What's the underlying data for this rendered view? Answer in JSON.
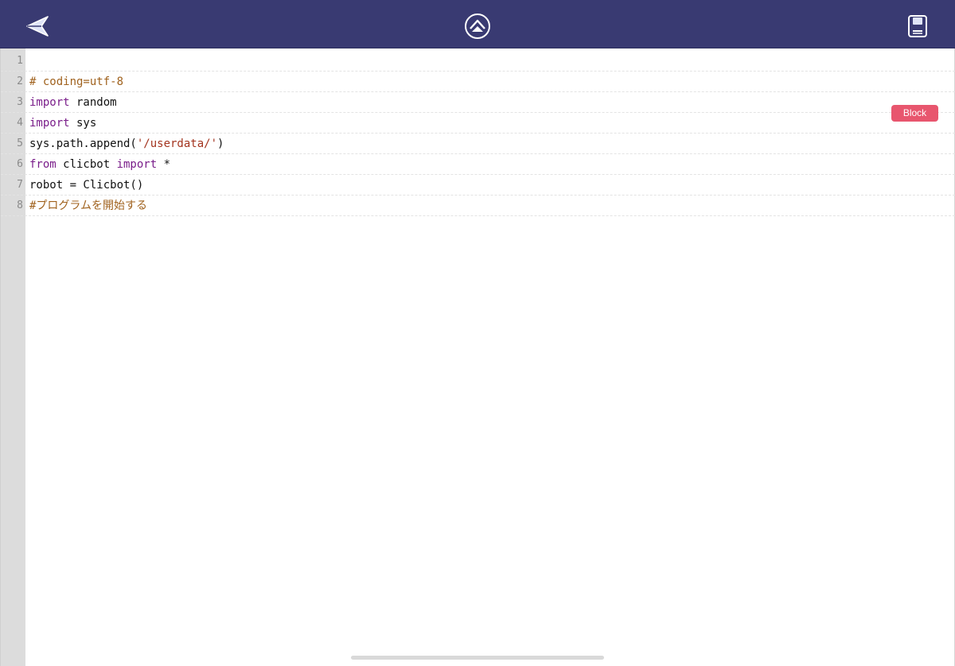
{
  "toolbar": {
    "back_icon": "paper-plane-back-icon",
    "center_icon": "chevron-up-circle-icon",
    "save_icon": "floppy-save-icon",
    "background_color": "#393a72"
  },
  "editor": {
    "lines": [
      {
        "number": "1",
        "tokens": []
      },
      {
        "number": "2",
        "tokens": [
          {
            "text": "# coding=utf-8",
            "type": "comment"
          }
        ]
      },
      {
        "number": "3",
        "tokens": [
          {
            "text": "import",
            "type": "keyword"
          },
          {
            "text": " random",
            "type": "text"
          }
        ]
      },
      {
        "number": "4",
        "tokens": [
          {
            "text": "import",
            "type": "keyword"
          },
          {
            "text": " sys",
            "type": "text"
          }
        ]
      },
      {
        "number": "5",
        "tokens": [
          {
            "text": "sys.path.append(",
            "type": "text"
          },
          {
            "text": "'/userdata/'",
            "type": "string"
          },
          {
            "text": ")",
            "type": "text"
          }
        ]
      },
      {
        "number": "6",
        "tokens": [
          {
            "text": "from",
            "type": "keyword"
          },
          {
            "text": " clicbot ",
            "type": "text"
          },
          {
            "text": "import",
            "type": "keyword"
          },
          {
            "text": " *",
            "type": "text"
          }
        ]
      },
      {
        "number": "7",
        "tokens": [
          {
            "text": "robot = Clicbot()",
            "type": "text"
          }
        ]
      },
      {
        "number": "8",
        "tokens": [
          {
            "text": "#プログラムを開始する",
            "type": "comment"
          }
        ]
      }
    ]
  },
  "block_button": {
    "label": "Block",
    "color": "#e8566e"
  }
}
